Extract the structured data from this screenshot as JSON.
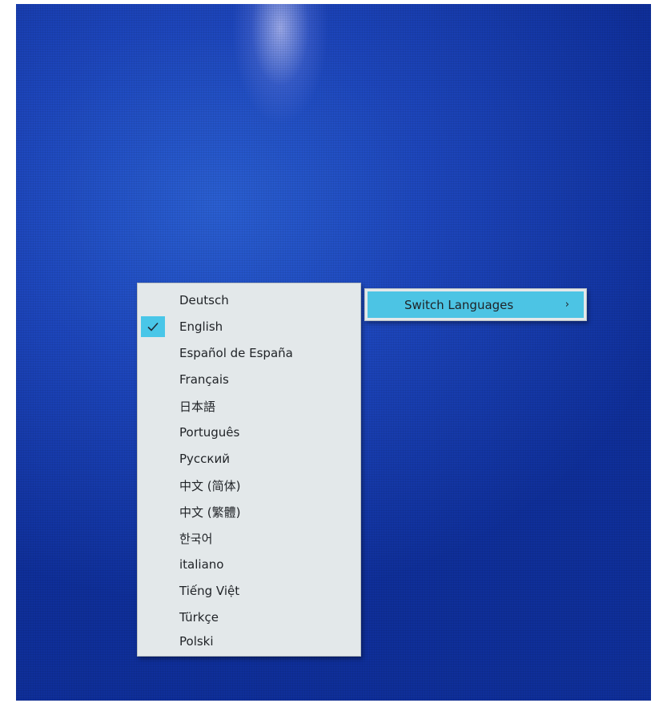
{
  "menu": {
    "items": [
      {
        "label": "Deutsch",
        "checked": false
      },
      {
        "label": "English",
        "checked": true
      },
      {
        "label": "Español de España",
        "checked": false
      },
      {
        "label": "Français",
        "checked": false
      },
      {
        "label": "日本語",
        "checked": false
      },
      {
        "label": "Português",
        "checked": false
      },
      {
        "label": "Русский",
        "checked": false
      },
      {
        "label": "中文 (简体)",
        "checked": false
      },
      {
        "label": "中文 (繁體)",
        "checked": false
      },
      {
        "label": "한국어",
        "checked": false
      },
      {
        "label": "italiano",
        "checked": false
      },
      {
        "label": "Tiếng Việt",
        "checked": false
      },
      {
        "label": "Türkçe",
        "checked": false
      },
      {
        "label": "Polski",
        "checked": false
      }
    ]
  },
  "submenu": {
    "label": "Switch Languages",
    "arrow": "›",
    "highlight_color": "#4cc4e4"
  },
  "icons": {
    "check": "checkmark-icon"
  },
  "colors": {
    "desktop": "#1d46bc",
    "menu_bg": "#e3e8ea",
    "check_bg": "#49c6e8"
  }
}
